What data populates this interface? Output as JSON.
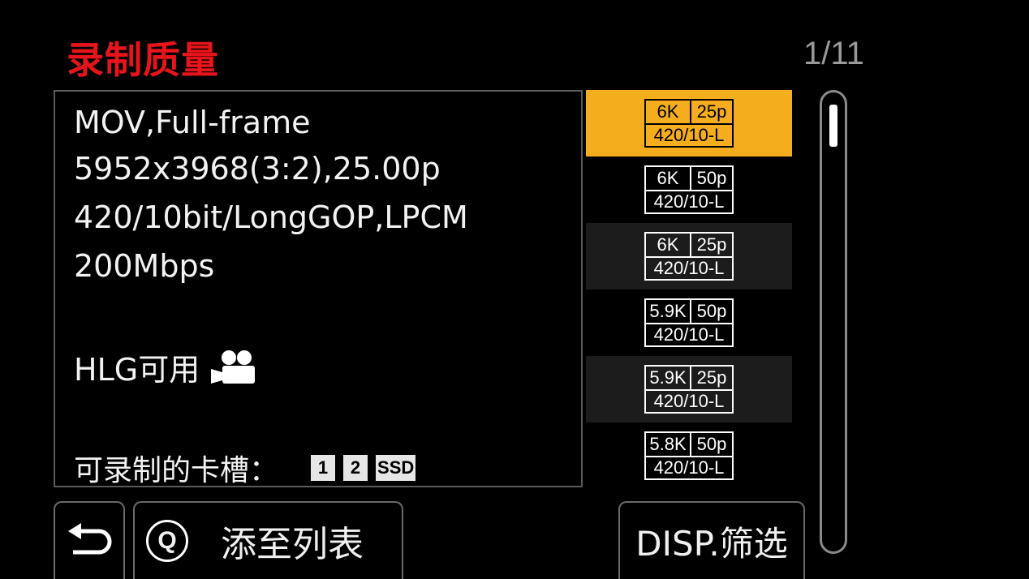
{
  "header": {
    "title": "录制质量",
    "page": "1/11"
  },
  "info": {
    "format": "MOV,Full-frame",
    "resolution": "5952x3968(3:2),25.00p",
    "codec": "420/10bit/LongGOP,LPCM",
    "bitrate": "200Mbps",
    "hlg": "HLG可用",
    "slots_label": "可录制的卡槽：",
    "slots": [
      "1",
      "2",
      "SSD"
    ]
  },
  "list": [
    {
      "res": "6K",
      "fps": "25p",
      "codec": "420/10-L",
      "selected": true
    },
    {
      "res": "6K",
      "fps": "50p",
      "codec": "420/10-L"
    },
    {
      "res": "6K",
      "fps": "25p",
      "codec": "420/10-L"
    },
    {
      "res": "5.9K",
      "fps": "50p",
      "codec": "420/10-L"
    },
    {
      "res": "5.9K",
      "fps": "25p",
      "codec": "420/10-L"
    },
    {
      "res": "5.8K",
      "fps": "50p",
      "codec": "420/10-L"
    }
  ],
  "buttons": {
    "add_label": "添至列表",
    "q_key": "Q",
    "disp_label": "DISP.筛选"
  },
  "colors": {
    "title": "#e8141b",
    "selected": "#f4ad1d"
  },
  "icons": {
    "hlg": "movie-camera-icon",
    "back": "return-arrow-icon",
    "q": "q-button-icon"
  }
}
